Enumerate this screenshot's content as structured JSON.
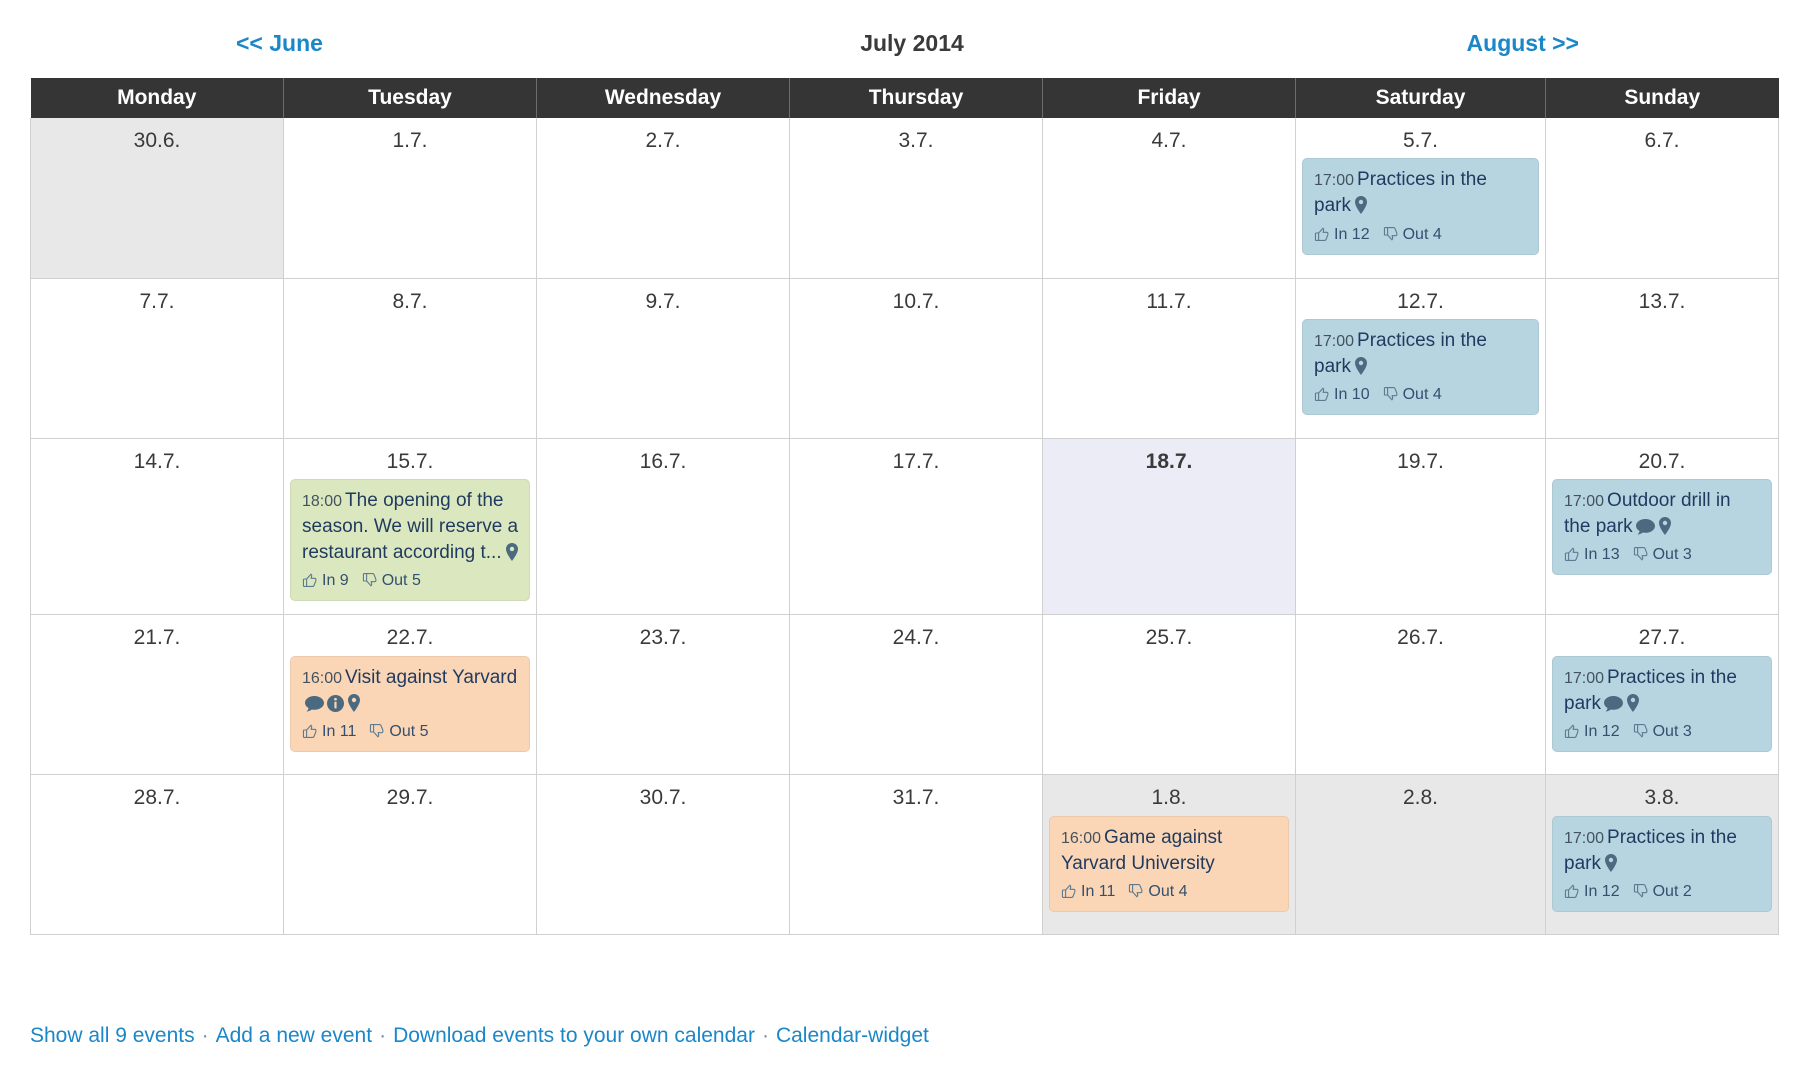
{
  "nav": {
    "prev_label": "<< June",
    "title": "July 2014",
    "next_label": "August >>"
  },
  "weekdays": [
    "Monday",
    "Tuesday",
    "Wednesday",
    "Thursday",
    "Friday",
    "Saturday",
    "Sunday"
  ],
  "footer": {
    "links": [
      "Show all 9 events",
      "Add a new event",
      "Download events to your own calendar",
      "Calendar-widget"
    ],
    "separator": "·"
  },
  "colors": {
    "header_bg": "#353535",
    "link_blue": "#1a87c8",
    "event_blue": "#b6d5e1",
    "event_green": "#dbe8bf",
    "event_orange": "#fbd6b6",
    "other_month_bg": "#e8e8e8",
    "today_bg": "#ececf7",
    "event_text": "#1f3a5f"
  },
  "weeks": [
    [
      {
        "daynum": "30.6.",
        "other_month": true,
        "today": false,
        "events": []
      },
      {
        "daynum": "1.7.",
        "other_month": false,
        "today": false,
        "events": []
      },
      {
        "daynum": "2.7.",
        "other_month": false,
        "today": false,
        "events": []
      },
      {
        "daynum": "3.7.",
        "other_month": false,
        "today": false,
        "events": []
      },
      {
        "daynum": "4.7.",
        "other_month": false,
        "today": false,
        "events": []
      },
      {
        "daynum": "5.7.",
        "other_month": false,
        "today": false,
        "events": [
          {
            "time": "17:00",
            "title": "Practices in the park",
            "color": "blue",
            "icons": [
              "location-pin-icon"
            ],
            "in_label": "In",
            "in_count": "12",
            "out_label": "Out",
            "out_count": "4"
          }
        ]
      },
      {
        "daynum": "6.7.",
        "other_month": false,
        "today": false,
        "events": []
      }
    ],
    [
      {
        "daynum": "7.7.",
        "other_month": false,
        "today": false,
        "events": []
      },
      {
        "daynum": "8.7.",
        "other_month": false,
        "today": false,
        "events": []
      },
      {
        "daynum": "9.7.",
        "other_month": false,
        "today": false,
        "events": []
      },
      {
        "daynum": "10.7.",
        "other_month": false,
        "today": false,
        "events": []
      },
      {
        "daynum": "11.7.",
        "other_month": false,
        "today": false,
        "events": []
      },
      {
        "daynum": "12.7.",
        "other_month": false,
        "today": false,
        "events": [
          {
            "time": "17:00",
            "title": "Practices in the park",
            "color": "blue",
            "icons": [
              "location-pin-icon"
            ],
            "in_label": "In",
            "in_count": "10",
            "out_label": "Out",
            "out_count": "4"
          }
        ]
      },
      {
        "daynum": "13.7.",
        "other_month": false,
        "today": false,
        "events": []
      }
    ],
    [
      {
        "daynum": "14.7.",
        "other_month": false,
        "today": false,
        "events": []
      },
      {
        "daynum": "15.7.",
        "other_month": false,
        "today": false,
        "events": [
          {
            "time": "18:00",
            "title": "The opening of the season. We will reserve a restaurant according t...",
            "color": "green",
            "icons": [
              "location-pin-icon"
            ],
            "in_label": "In",
            "in_count": "9",
            "out_label": "Out",
            "out_count": "5"
          }
        ]
      },
      {
        "daynum": "16.7.",
        "other_month": false,
        "today": false,
        "events": []
      },
      {
        "daynum": "17.7.",
        "other_month": false,
        "today": false,
        "events": []
      },
      {
        "daynum": "18.7.",
        "other_month": false,
        "today": true,
        "events": []
      },
      {
        "daynum": "19.7.",
        "other_month": false,
        "today": false,
        "events": []
      },
      {
        "daynum": "20.7.",
        "other_month": false,
        "today": false,
        "events": [
          {
            "time": "17:00",
            "title": "Outdoor drill in the park",
            "color": "blue",
            "icons": [
              "comment-icon",
              "location-pin-icon"
            ],
            "in_label": "In",
            "in_count": "13",
            "out_label": "Out",
            "out_count": "3"
          }
        ]
      }
    ],
    [
      {
        "daynum": "21.7.",
        "other_month": false,
        "today": false,
        "events": []
      },
      {
        "daynum": "22.7.",
        "other_month": false,
        "today": false,
        "events": [
          {
            "time": "16:00",
            "title": "Visit against Yarvard",
            "color": "orange",
            "icons": [
              "comment-icon",
              "info-icon",
              "location-pin-icon"
            ],
            "in_label": "In",
            "in_count": "11",
            "out_label": "Out",
            "out_count": "5"
          }
        ]
      },
      {
        "daynum": "23.7.",
        "other_month": false,
        "today": false,
        "events": []
      },
      {
        "daynum": "24.7.",
        "other_month": false,
        "today": false,
        "events": []
      },
      {
        "daynum": "25.7.",
        "other_month": false,
        "today": false,
        "events": []
      },
      {
        "daynum": "26.7.",
        "other_month": false,
        "today": false,
        "events": []
      },
      {
        "daynum": "27.7.",
        "other_month": false,
        "today": false,
        "events": [
          {
            "time": "17:00",
            "title": "Practices in the park",
            "color": "blue",
            "icons": [
              "comment-icon",
              "location-pin-icon"
            ],
            "in_label": "In",
            "in_count": "12",
            "out_label": "Out",
            "out_count": "3"
          }
        ]
      }
    ],
    [
      {
        "daynum": "28.7.",
        "other_month": false,
        "today": false,
        "events": []
      },
      {
        "daynum": "29.7.",
        "other_month": false,
        "today": false,
        "events": []
      },
      {
        "daynum": "30.7.",
        "other_month": false,
        "today": false,
        "events": []
      },
      {
        "daynum": "31.7.",
        "other_month": false,
        "today": false,
        "events": []
      },
      {
        "daynum": "1.8.",
        "other_month": true,
        "today": false,
        "events": [
          {
            "time": "16:00",
            "title": "Game against Yarvard University",
            "color": "orange",
            "icons": [],
            "in_label": "In",
            "in_count": "11",
            "out_label": "Out",
            "out_count": "4"
          }
        ]
      },
      {
        "daynum": "2.8.",
        "other_month": true,
        "today": false,
        "events": []
      },
      {
        "daynum": "3.8.",
        "other_month": true,
        "today": false,
        "events": [
          {
            "time": "17:00",
            "title": "Practices in the park",
            "color": "blue",
            "icons": [
              "location-pin-icon"
            ],
            "in_label": "In",
            "in_count": "12",
            "out_label": "Out",
            "out_count": "2"
          }
        ]
      }
    ]
  ]
}
